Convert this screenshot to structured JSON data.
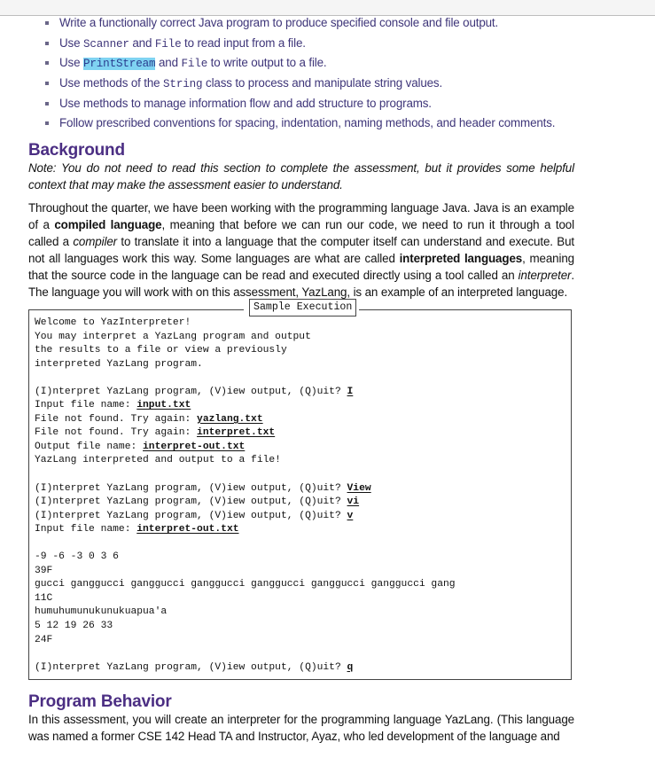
{
  "objectives": [
    {
      "parts": [
        {
          "t": "Write a functionally correct Java program to produce specified console and file output."
        }
      ]
    },
    {
      "parts": [
        {
          "t": "Use "
        },
        {
          "t": "Scanner",
          "code": true
        },
        {
          "t": " and "
        },
        {
          "t": "File",
          "code": true
        },
        {
          "t": " to read input from a file."
        }
      ]
    },
    {
      "parts": [
        {
          "t": "Use "
        },
        {
          "t": "PrintStream",
          "code": true,
          "highlight": true
        },
        {
          "t": " and "
        },
        {
          "t": "File",
          "code": true
        },
        {
          "t": " to write output to a file."
        }
      ]
    },
    {
      "parts": [
        {
          "t": "Use methods of the "
        },
        {
          "t": "String",
          "code": true
        },
        {
          "t": " class to process and manipulate string values."
        }
      ]
    },
    {
      "parts": [
        {
          "t": "Use methods to manage information flow and add structure to programs."
        }
      ]
    },
    {
      "parts": [
        {
          "t": "Follow prescribed conventions for spacing, indentation, naming methods, and header comments."
        }
      ]
    }
  ],
  "background": {
    "heading": "Background",
    "note": "Note: You do not need to read this section to complete the assessment, but it provides some helpful context that may make the assessment easier to understand.",
    "paragraph": [
      {
        "t": "Throughout the quarter, we have been working with the programming language Java. Java is an example of a "
      },
      {
        "t": "compiled language",
        "style": "bold"
      },
      {
        "t": ", meaning that before we can run our code, we need to run it through a tool called a "
      },
      {
        "t": "compiler",
        "style": "italic"
      },
      {
        "t": " to translate it into a language that the computer itself can understand and execute. But not all languages work this way. Some languages are what are called "
      },
      {
        "t": "interpreted languages",
        "style": "bold"
      },
      {
        "t": ", meaning that the source code in the language can be read and executed directly using a tool called an "
      },
      {
        "t": "interpreter",
        "style": "italic"
      },
      {
        "t": ". The language you will work with on this assessment, YazLang, is an example of an interpreted language."
      }
    ]
  },
  "sample_execution": {
    "label": "Sample Execution",
    "lines": [
      {
        "text": "Welcome to YazInterpreter!"
      },
      {
        "text": "You may interpret a YazLang program and output"
      },
      {
        "text": "the results to a file or view a previously"
      },
      {
        "text": "interpreted YazLang program."
      },
      {
        "text": ""
      },
      {
        "text": "(I)nterpret YazLang program, (V)iew output, (Q)uit? ",
        "input": "I"
      },
      {
        "text": "Input file name: ",
        "input": "input.txt"
      },
      {
        "text": "File not found. Try again: ",
        "input": "yazlang.txt"
      },
      {
        "text": "File not found. Try again: ",
        "input": "interpret.txt"
      },
      {
        "text": "Output file name: ",
        "input": "interpret-out.txt"
      },
      {
        "text": "YazLang interpreted and output to a file!"
      },
      {
        "text": ""
      },
      {
        "text": "(I)nterpret YazLang program, (V)iew output, (Q)uit? ",
        "input": "View"
      },
      {
        "text": "(I)nterpret YazLang program, (V)iew output, (Q)uit? ",
        "input": "vi"
      },
      {
        "text": "(I)nterpret YazLang program, (V)iew output, (Q)uit? ",
        "input": "v"
      },
      {
        "text": "Input file name: ",
        "input": "interpret-out.txt"
      },
      {
        "text": ""
      },
      {
        "text": "-9 -6 -3 0 3 6"
      },
      {
        "text": "39F"
      },
      {
        "text": "gucci ganggucci ganggucci ganggucci ganggucci ganggucci ganggucci gang"
      },
      {
        "text": "11C"
      },
      {
        "text": "humuhumunukunukuapua'a"
      },
      {
        "text": "5 12 19 26 33"
      },
      {
        "text": "24F"
      },
      {
        "text": ""
      },
      {
        "text": "(I)nterpret YazLang program, (V)iew output, (Q)uit? ",
        "input": "q"
      }
    ]
  },
  "program_behavior": {
    "heading": "Program Behavior",
    "paragraph": "In this assessment, you will create an interpreter for the programming language YazLang. (This language was named a former CSE 142 Head TA and Instructor, Ayaz, who led development of the language and"
  }
}
